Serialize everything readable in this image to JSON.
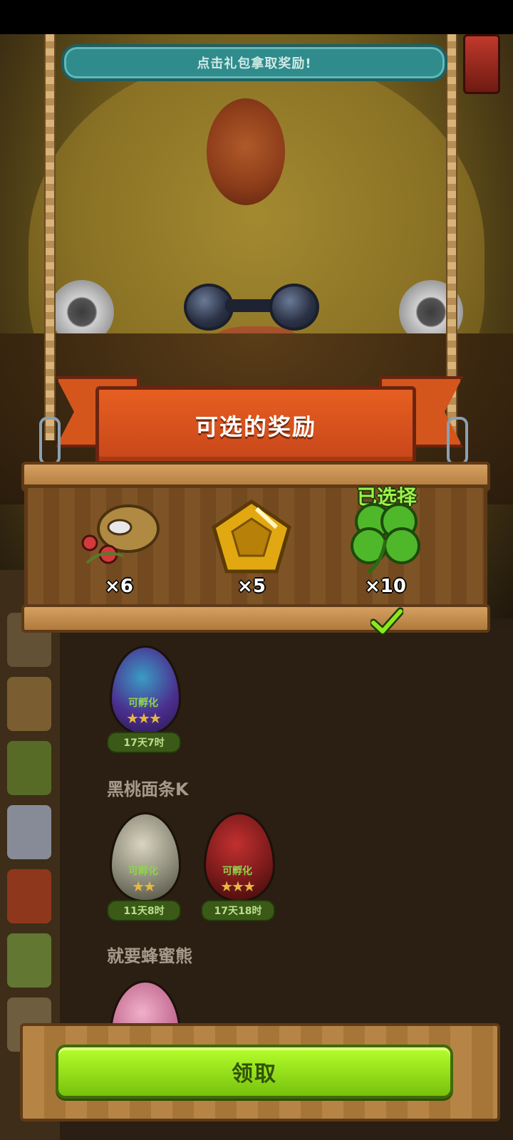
{
  "hint_banner": {
    "text": "点击礼包拿取奖励!"
  },
  "reward_panel": {
    "title": "可选的奖励",
    "selected_label": "已选择",
    "rewards": [
      {
        "icon": "peanut-pest-icon",
        "count": "×6"
      },
      {
        "icon": "gold-gem-icon",
        "count": "×5"
      },
      {
        "icon": "four-leaf-clover-icon",
        "count": "×10",
        "selected": true
      }
    ]
  },
  "egg_sections": [
    {
      "owner": "",
      "eggs": [
        {
          "status": "可孵化",
          "stars": "★★★",
          "timer": "17天7时",
          "color": "#4b2f8f"
        }
      ]
    },
    {
      "owner": "黑桃面条K",
      "eggs": [
        {
          "status": "可孵化",
          "stars": "★★",
          "timer": "11天8时",
          "color": "#8b8a78"
        },
        {
          "status": "可孵化",
          "stars": "★★★",
          "timer": "17天18时",
          "color": "#7a1a1a"
        }
      ]
    },
    {
      "owner": "就要蜂蜜熊",
      "eggs": []
    }
  ],
  "footer": {
    "claim_label": "领取"
  },
  "colors": {
    "accent_green": "#8ee81a",
    "banner_orange": "#e65f21",
    "hint_teal": "#2f8b8c"
  }
}
